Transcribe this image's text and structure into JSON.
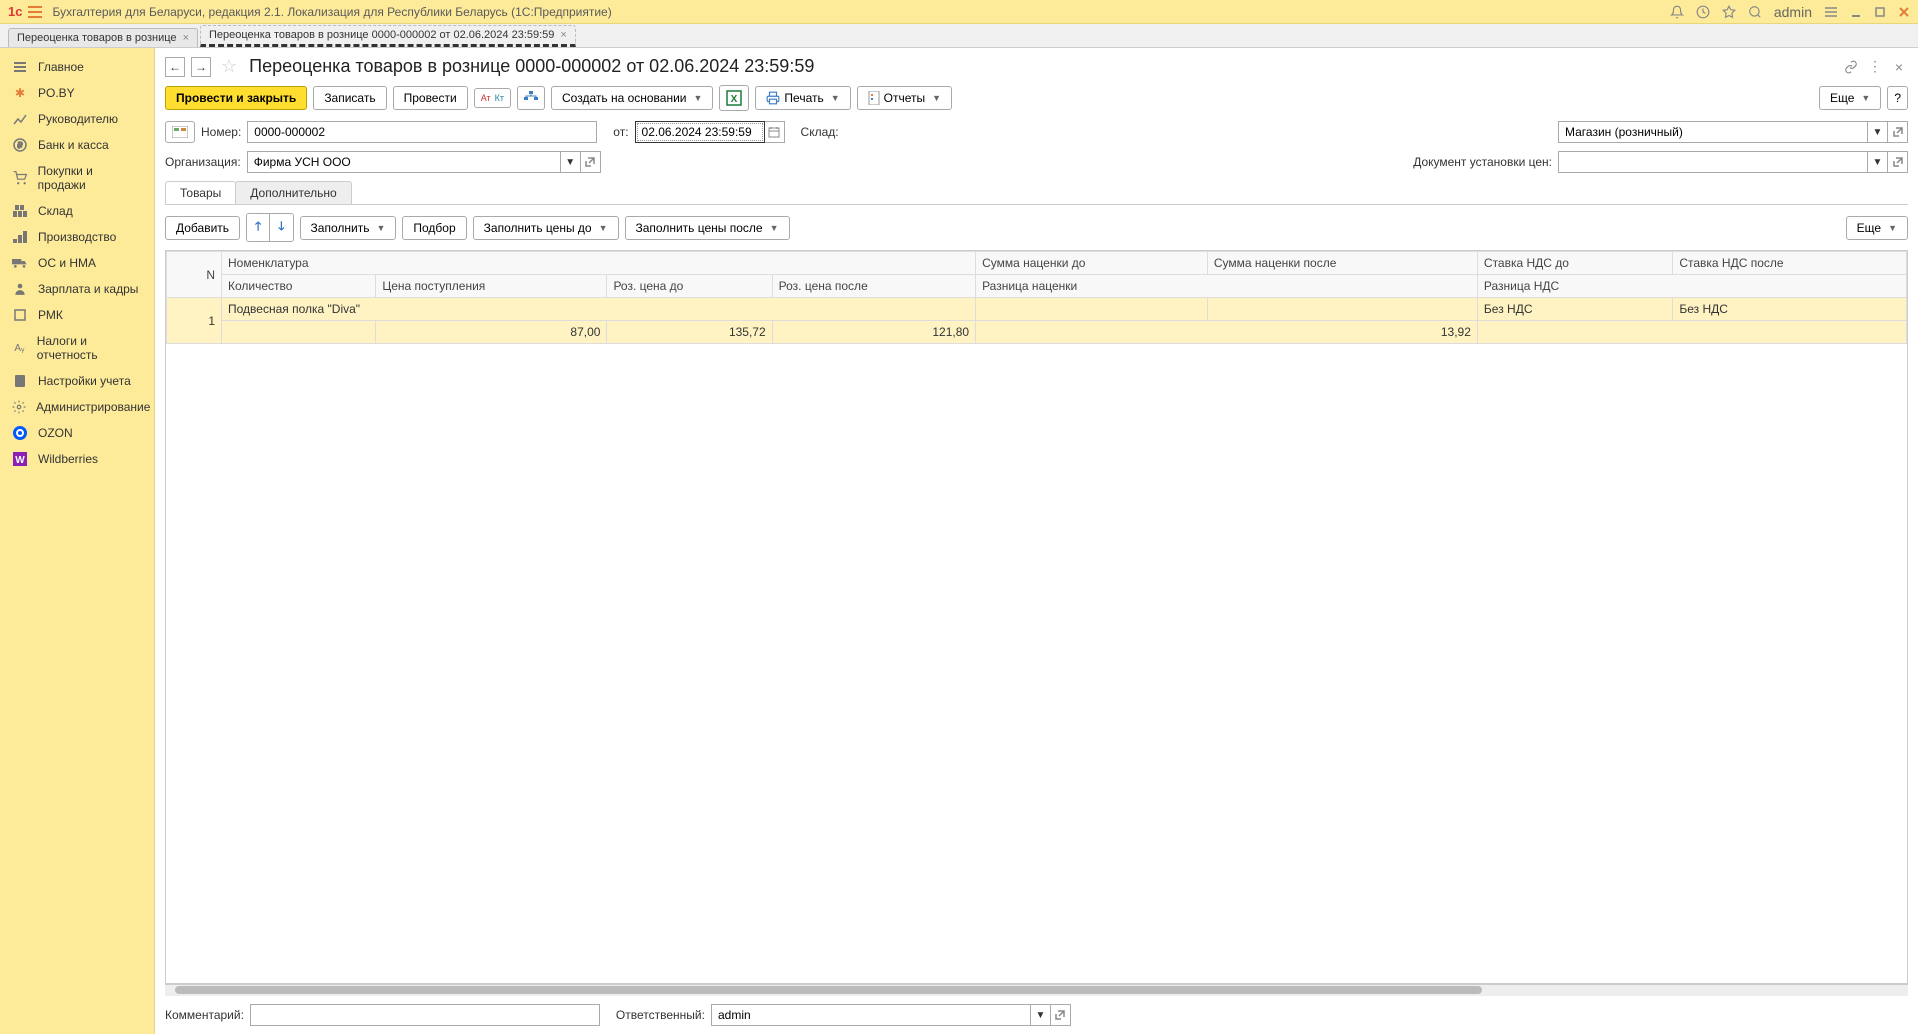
{
  "titlebar": {
    "app_title": "Бухгалтерия для Беларуси, редакция 2.1. Локализация для Республики Беларусь   (1С:Предприятие)",
    "user": "admin"
  },
  "tabs": [
    {
      "label": "Переоценка товаров в рознице"
    },
    {
      "label": "Переоценка товаров в рознице 0000-000002 от 02.06.2024 23:59:59"
    }
  ],
  "sidebar": {
    "items": [
      {
        "label": "Главное"
      },
      {
        "label": "PO.BY"
      },
      {
        "label": "Руководителю"
      },
      {
        "label": "Банк и касса"
      },
      {
        "label": "Покупки и продажи"
      },
      {
        "label": "Склад"
      },
      {
        "label": "Производство"
      },
      {
        "label": "ОС и НМА"
      },
      {
        "label": "Зарплата и кадры"
      },
      {
        "label": "РМК"
      },
      {
        "label": "Налоги и отчетность"
      },
      {
        "label": "Настройки учета"
      },
      {
        "label": "Администрирование"
      },
      {
        "label": "OZON"
      },
      {
        "label": "Wildberries"
      }
    ]
  },
  "doc": {
    "title": "Переоценка товаров в рознице 0000-000002 от 02.06.2024 23:59:59",
    "toolbar": {
      "post_close": "Провести и закрыть",
      "save": "Записать",
      "post": "Провести",
      "create_based": "Создать на основании",
      "print": "Печать",
      "reports": "Отчеты",
      "more": "Еще"
    },
    "fields": {
      "number_label": "Номер:",
      "number_value": "0000-000002",
      "date_label": "от:",
      "date_value": "02.06.2024 23:59:59",
      "warehouse_label": "Склад:",
      "warehouse_value": "Магазин (розничный)",
      "org_label": "Организация:",
      "org_value": "Фирма УСН ООО",
      "pricedoc_label": "Документ установки цен:",
      "pricedoc_value": ""
    },
    "section_tabs": {
      "goods": "Товары",
      "extra": "Дополнительно"
    },
    "subtoolbar": {
      "add": "Добавить",
      "fill": "Заполнить",
      "pick": "Подбор",
      "fill_prices_before": "Заполнить цены до",
      "fill_prices_after": "Заполнить цены после",
      "more": "Еще"
    },
    "table": {
      "headers_row1": [
        "N",
        "Номенклатура",
        "Сумма наценки до",
        "Сумма наценки после",
        "Ставка НДС до",
        "Ставка НДС после"
      ],
      "headers_row2": [
        "Количество",
        "Цена поступления",
        "Роз. цена до",
        "Роз. цена после",
        "Разница наценки",
        "Разница НДС"
      ],
      "rows": [
        {
          "n": "1",
          "nomenclature": "Подвесная полка \"Diva\"",
          "markup_before": "",
          "markup_after": "",
          "vat_before": "Без НДС",
          "vat_after": "Без НДС",
          "qty": "",
          "price_in": "87,00",
          "retail_before": "135,72",
          "retail_after": "121,80",
          "markup_diff": "13,92",
          "vat_diff": ""
        }
      ]
    },
    "footer": {
      "comment_label": "Комментарий:",
      "comment_value": "",
      "responsible_label": "Ответственный:",
      "responsible_value": "admin"
    }
  }
}
